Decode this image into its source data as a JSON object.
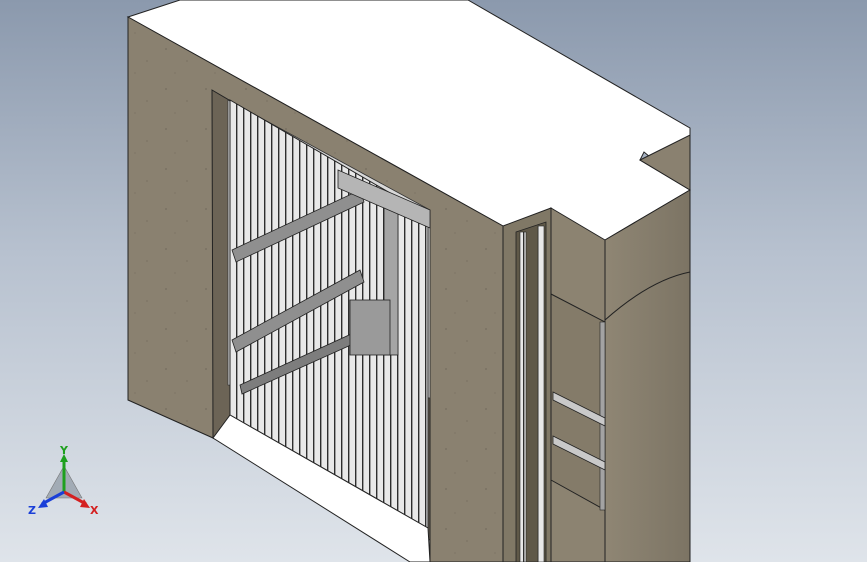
{
  "view": {
    "background_top": "#8b99ad",
    "background_bottom": "#dfe4ea"
  },
  "model": {
    "wall_color": "#8a8170",
    "wall_dark": "#6f6758",
    "top_color": "#ffffff",
    "bars_color": "#3a3a3a",
    "steel_color": "#9a9a9a"
  },
  "triad": {
    "x_label": "X",
    "y_label": "Y",
    "z_label": "Z",
    "x_color": "#d42020",
    "y_color": "#1ea01e",
    "z_color": "#1a3fd8",
    "icon": "coordinate-triad-icon"
  }
}
